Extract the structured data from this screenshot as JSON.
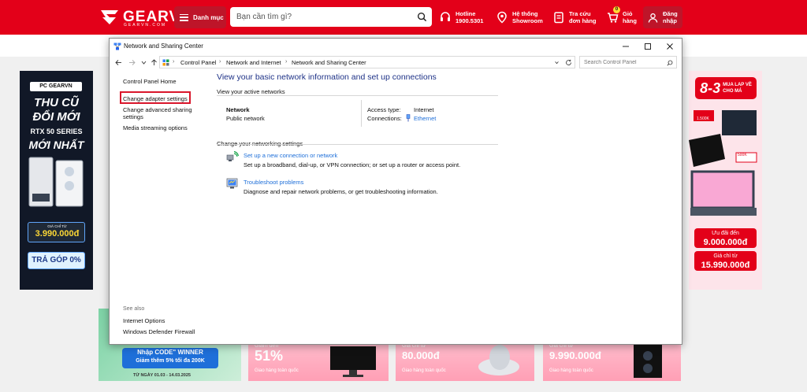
{
  "site": {
    "logo_text": "GEARVN",
    "logo_sub": "GEARVN.COM",
    "menu_label": "Danh mục",
    "search_placeholder": "Bạn cần tìm gì?",
    "hotline_label": "Hotline",
    "hotline_number": "1900.5301",
    "showroom_l1": "Hệ thống",
    "showroom_l2": "Showroom",
    "orders_l1": "Tra cứu",
    "orders_l2": "đơn hàng",
    "cart_l1": "Giỏ",
    "cart_l2": "hàng",
    "cart_count": "0",
    "login_l1": "Đăng",
    "login_l2": "nhập",
    "brand_color": "#e30019"
  },
  "banner_left": {
    "tag": "PC GEARVN",
    "line1": "THU CŨ",
    "line2": "ĐỔI MỚI",
    "line3": "RTX 50 SERIES",
    "line4": "MỚI NHẤT",
    "price_label": "GIÁ CHỈ TỪ",
    "price": "3.990.000đ",
    "installment": "TRẢ GÓP 0%"
  },
  "banner_right": {
    "big": "8-3",
    "small_l1": "MUA LAP VỀ",
    "small_l2": "CHO MÁ",
    "badge1": "1.500K",
    "badge2": "500K",
    "pill1_l1": "Ưu đãi đến",
    "pill1_l2": "9.000.000đ",
    "pill2_l1": "Giá chỉ từ",
    "pill2_l2": "15.990.000đ"
  },
  "promos": {
    "p1_code": "Nhập CODE\" WINNER",
    "p1_desc": "Giảm thêm 5% tối đa 200K",
    "p1_date": "TỪ NGÀY 01.03 - 14.03.2025",
    "p2_pct": "51%",
    "p2_from": "Giảm đến",
    "p2_ship": "Giao hàng toàn quốc",
    "p3_from": "Giá chỉ từ",
    "p3_amt": "80.000đ",
    "p3_ship": "Giao hàng toàn quốc",
    "p4_from": "Giá chỉ từ",
    "p4_amt": "9.990.000đ",
    "p4_ship": "Giao hàng toàn quốc"
  },
  "window": {
    "title": "Network and Sharing Center",
    "breadcrumb": [
      "Control Panel",
      "Network and Internet",
      "Network and Sharing Center"
    ],
    "search_placeholder": "Search Control Panel",
    "left_links": {
      "home": "Control Panel Home",
      "adapter": "Change adapter settings",
      "advanced_l1": "Change advanced sharing",
      "advanced_l2": "settings",
      "media": "Media streaming options"
    },
    "see_also_label": "See also",
    "see_also": [
      "Internet Options",
      "Windows Defender Firewall"
    ],
    "main_title": "View your basic network information and set up connections",
    "active_networks_label": "View your active networks",
    "network_name": "Network",
    "network_type": "Public network",
    "access_type_label": "Access type:",
    "access_type_value": "Internet",
    "connections_label": "Connections:",
    "connections_value": "Ethernet",
    "change_settings_label": "Change your networking settings",
    "tasks": [
      {
        "link": "Set up a new connection or network",
        "desc": "Set up a broadband, dial-up, or VPN connection; or set up a router or access point."
      },
      {
        "link": "Troubleshoot problems",
        "desc": "Diagnose and repair network problems, or get troubleshooting information."
      }
    ]
  }
}
